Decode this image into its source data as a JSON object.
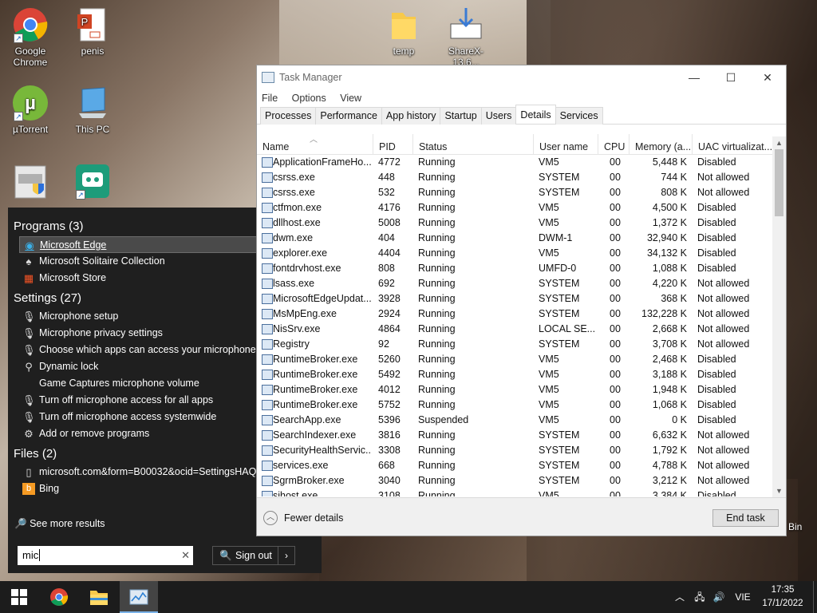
{
  "desktop": {
    "icons": [
      {
        "label": "Google Chrome",
        "icon": "chrome-icon"
      },
      {
        "label": "penis",
        "icon": "powerpoint-file-icon"
      },
      {
        "label": "temp",
        "icon": "folder-icon"
      },
      {
        "label": "ShareX-13.6...",
        "icon": "installer-icon"
      },
      {
        "label": "µTorrent",
        "icon": "utorrent-icon"
      },
      {
        "label": "This PC",
        "icon": "computer-icon"
      }
    ],
    "bin_label": "Bin"
  },
  "search_panel": {
    "programs_header": "Programs (3)",
    "programs": [
      {
        "label": "Microsoft Edge",
        "icon": "edge-icon"
      },
      {
        "label": "Microsoft Solitaire Collection",
        "icon": "cards-icon"
      },
      {
        "label": "Microsoft Store",
        "icon": "store-icon"
      }
    ],
    "settings_header": "Settings (27)",
    "settings": [
      {
        "label": "Microphone setup",
        "icon": "microphone-icon"
      },
      {
        "label": "Microphone privacy settings",
        "icon": "microphone-icon"
      },
      {
        "label": "Choose which apps can access your microphone",
        "icon": "microphone-icon"
      },
      {
        "label": "Dynamic lock",
        "icon": "key-icon"
      },
      {
        "label": "Game Captures microphone volume",
        "icon": "blank-icon"
      },
      {
        "label": "Turn off microphone access for all apps",
        "icon": "microphone-icon"
      },
      {
        "label": "Turn off microphone access systemwide",
        "icon": "microphone-icon"
      },
      {
        "label": "Add or remove programs",
        "icon": "gear-icon"
      }
    ],
    "files_header": "Files (2)",
    "files": [
      {
        "label": "microsoft.com&form=B00032&ocid=SettingsHAQ-",
        "icon": "document-icon"
      },
      {
        "label": "Bing",
        "icon": "bing-icon"
      }
    ],
    "see_more": "See more results",
    "search_value": "mic",
    "sign_out": "Sign out"
  },
  "task_manager": {
    "title": "Task Manager",
    "menu": [
      "File",
      "Options",
      "View"
    ],
    "tabs": [
      "Processes",
      "Performance",
      "App history",
      "Startup",
      "Users",
      "Details",
      "Services"
    ],
    "active_tab": "Details",
    "columns": [
      "Name",
      "PID",
      "Status",
      "User name",
      "CPU",
      "Memory (a...",
      "UAC virtualizat..."
    ],
    "rows": [
      [
        "ApplicationFrameHo...",
        "4772",
        "Running",
        "VM5",
        "00",
        "5,448 K",
        "Disabled"
      ],
      [
        "csrss.exe",
        "448",
        "Running",
        "SYSTEM",
        "00",
        "744 K",
        "Not allowed"
      ],
      [
        "csrss.exe",
        "532",
        "Running",
        "SYSTEM",
        "00",
        "808 K",
        "Not allowed"
      ],
      [
        "ctfmon.exe",
        "4176",
        "Running",
        "VM5",
        "00",
        "4,500 K",
        "Disabled"
      ],
      [
        "dllhost.exe",
        "5008",
        "Running",
        "VM5",
        "00",
        "1,372 K",
        "Disabled"
      ],
      [
        "dwm.exe",
        "404",
        "Running",
        "DWM-1",
        "00",
        "32,940 K",
        "Disabled"
      ],
      [
        "explorer.exe",
        "4404",
        "Running",
        "VM5",
        "00",
        "34,132 K",
        "Disabled"
      ],
      [
        "fontdrvhost.exe",
        "808",
        "Running",
        "UMFD-0",
        "00",
        "1,088 K",
        "Disabled"
      ],
      [
        "lsass.exe",
        "692",
        "Running",
        "SYSTEM",
        "00",
        "4,220 K",
        "Not allowed"
      ],
      [
        "MicrosoftEdgeUpdat...",
        "3928",
        "Running",
        "SYSTEM",
        "00",
        "368 K",
        "Not allowed"
      ],
      [
        "MsMpEng.exe",
        "2924",
        "Running",
        "SYSTEM",
        "00",
        "132,228 K",
        "Not allowed"
      ],
      [
        "NisSrv.exe",
        "4864",
        "Running",
        "LOCAL SE...",
        "00",
        "2,668 K",
        "Not allowed"
      ],
      [
        "Registry",
        "92",
        "Running",
        "SYSTEM",
        "00",
        "3,708 K",
        "Not allowed"
      ],
      [
        "RuntimeBroker.exe",
        "5260",
        "Running",
        "VM5",
        "00",
        "2,468 K",
        "Disabled"
      ],
      [
        "RuntimeBroker.exe",
        "5492",
        "Running",
        "VM5",
        "00",
        "3,188 K",
        "Disabled"
      ],
      [
        "RuntimeBroker.exe",
        "4012",
        "Running",
        "VM5",
        "00",
        "1,948 K",
        "Disabled"
      ],
      [
        "RuntimeBroker.exe",
        "5752",
        "Running",
        "VM5",
        "00",
        "1,068 K",
        "Disabled"
      ],
      [
        "SearchApp.exe",
        "5396",
        "Suspended",
        "VM5",
        "00",
        "0 K",
        "Disabled"
      ],
      [
        "SearchIndexer.exe",
        "3816",
        "Running",
        "SYSTEM",
        "00",
        "6,632 K",
        "Not allowed"
      ],
      [
        "SecurityHealthServic...",
        "3308",
        "Running",
        "SYSTEM",
        "00",
        "1,792 K",
        "Not allowed"
      ],
      [
        "services.exe",
        "668",
        "Running",
        "SYSTEM",
        "00",
        "4,788 K",
        "Not allowed"
      ],
      [
        "SgrmBroker.exe",
        "3040",
        "Running",
        "SYSTEM",
        "00",
        "3,212 K",
        "Not allowed"
      ],
      [
        "sihost.exe",
        "3108",
        "Running",
        "VM5",
        "00",
        "3,384 K",
        "Disabled"
      ]
    ],
    "fewer_details": "Fewer details",
    "end_task": "End task"
  },
  "taskbar": {
    "language": "VIE",
    "time": "17:35",
    "date": "17/1/2022"
  }
}
